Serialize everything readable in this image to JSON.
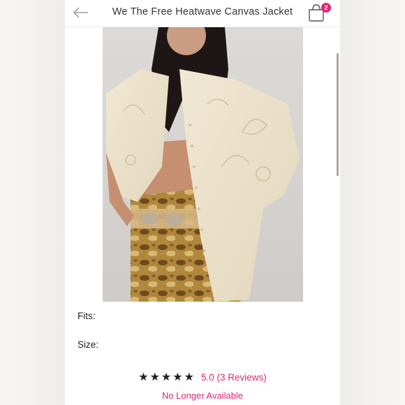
{
  "header": {
    "title": "We The Free Heatwave Canvas Jacket",
    "bag_count": "2",
    "back_icon": "arrow-left-icon",
    "bag_icon": "shopping-bag-icon"
  },
  "product": {
    "image_alt": "Model wearing cream embroidered canvas jacket with printed flare pants"
  },
  "details": {
    "fits_label": "Fits:",
    "size_label": "Size:"
  },
  "reviews": {
    "stars": "★★★★★",
    "summary": "5.0 (3 Reviews)"
  },
  "availability": "No Longer Available",
  "colors": {
    "accent": "#e0286f",
    "background": "#ffffff"
  }
}
